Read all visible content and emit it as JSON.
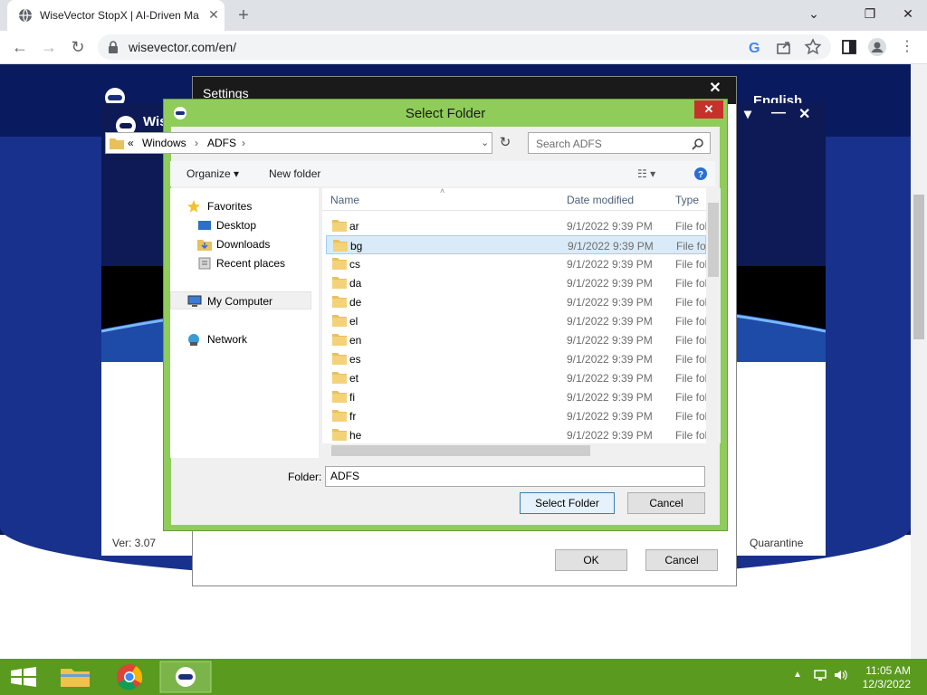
{
  "browser": {
    "tab_title": "WiseVector StopX | AI-Driven Ma",
    "url": "wisevector.com/en/",
    "window_controls": [
      "minimize",
      "restore",
      "close"
    ]
  },
  "page": {
    "language": "English"
  },
  "app": {
    "name": "Wis",
    "version": "Ver: 3.07",
    "quarantine": "Quarantine"
  },
  "settings": {
    "title": "Settings",
    "ok": "OK",
    "cancel": "Cancel"
  },
  "select_folder": {
    "title": "Select Folder",
    "breadcrumb": [
      "«",
      "Windows",
      "ADFS"
    ],
    "search_placeholder": "Search ADFS",
    "commands": {
      "organize": "Organize",
      "new_folder": "New folder"
    },
    "nav": {
      "favorites": "Favorites",
      "desktop": "Desktop",
      "downloads": "Downloads",
      "recent": "Recent places",
      "computer": "My Computer",
      "network": "Network"
    },
    "columns": {
      "name": "Name",
      "date": "Date modified",
      "type": "Type"
    },
    "rows": [
      {
        "name": "ar",
        "date": "9/1/2022 9:39 PM",
        "type": "File fol"
      },
      {
        "name": "bg",
        "date": "9/1/2022 9:39 PM",
        "type": "File fol"
      },
      {
        "name": "cs",
        "date": "9/1/2022 9:39 PM",
        "type": "File fol"
      },
      {
        "name": "da",
        "date": "9/1/2022 9:39 PM",
        "type": "File fol"
      },
      {
        "name": "de",
        "date": "9/1/2022 9:39 PM",
        "type": "File fol"
      },
      {
        "name": "el",
        "date": "9/1/2022 9:39 PM",
        "type": "File fol"
      },
      {
        "name": "en",
        "date": "9/1/2022 9:39 PM",
        "type": "File fol"
      },
      {
        "name": "es",
        "date": "9/1/2022 9:39 PM",
        "type": "File fol"
      },
      {
        "name": "et",
        "date": "9/1/2022 9:39 PM",
        "type": "File fol"
      },
      {
        "name": "fi",
        "date": "9/1/2022 9:39 PM",
        "type": "File fol"
      },
      {
        "name": "fr",
        "date": "9/1/2022 9:39 PM",
        "type": "File fol"
      },
      {
        "name": "he",
        "date": "9/1/2022 9:39 PM",
        "type": "File fol"
      }
    ],
    "selected_row": 1,
    "folder_label": "Folder:",
    "folder_value": "ADFS",
    "select_button": "Select Folder",
    "cancel_button": "Cancel"
  },
  "taskbar": {
    "time": "11:05 AM",
    "date": "12/3/2022"
  },
  "colors": {
    "dialog_frame": "#8fcc5a",
    "taskbar": "#5a9a1e",
    "selection": "#d9ebf9",
    "close_red": "#c7312b"
  }
}
